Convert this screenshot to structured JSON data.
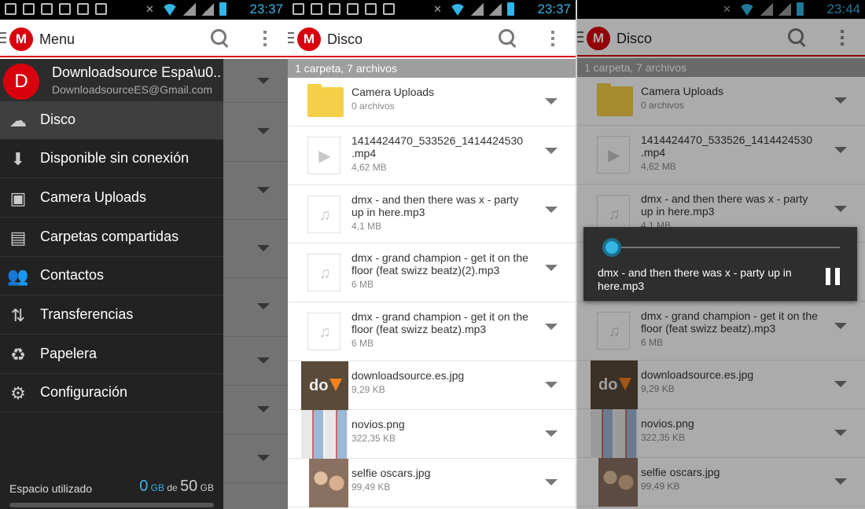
{
  "status": {
    "time1": "23:37",
    "time2": "23:37",
    "time3": "23:44"
  },
  "drawer_toolbar_title": "Menu",
  "disco_title": "Disco",
  "folder_summary": "1 carpeta, 7 archivos",
  "account": {
    "initial": "D",
    "name": "Downloadsource Espa\\u0..",
    "email": "DownloadsourceES@Gmail.com"
  },
  "nav": [
    {
      "label": "Disco",
      "icon": "cloud-icon"
    },
    {
      "label": "Disponible sin conexión",
      "icon": "download-icon"
    },
    {
      "label": "Camera Uploads",
      "icon": "image-icon"
    },
    {
      "label": "Carpetas compartidas",
      "icon": "shared-folder-icon"
    },
    {
      "label": "Contactos",
      "icon": "contacts-icon"
    },
    {
      "label": "Transferencias",
      "icon": "transfers-icon"
    },
    {
      "label": "Papelera",
      "icon": "recycle-icon"
    },
    {
      "label": "Configuración",
      "icon": "gear-icon"
    }
  ],
  "usage": {
    "label": "Espacio utilizado",
    "used": "0",
    "unit1": "GB",
    "of": "de",
    "total": "50",
    "unit2": "GB"
  },
  "files": [
    {
      "name": "Camera Uploads",
      "size": "0 archivos",
      "kind": "folder"
    },
    {
      "name": "1414424470_533526_1414424530 .mp4",
      "size": "4,62 MB",
      "kind": "video"
    },
    {
      "name": "dmx - and then there was x - party up in here.mp3",
      "size": "4,1 MB",
      "kind": "audio"
    },
    {
      "name": "dmx - grand champion - get it on the floor (feat swizz beatz)(2).mp3",
      "size": "6 MB",
      "kind": "audio"
    },
    {
      "name": "dmx - grand champion - get it on the floor (feat swizz beatz).mp3",
      "size": "6 MB",
      "kind": "audio"
    },
    {
      "name": "downloadsource.es.jpg",
      "size": "9,29 KB",
      "kind": "image-do"
    },
    {
      "name": "novios.png",
      "size": "322,35 KB",
      "kind": "image-comic"
    },
    {
      "name": "selfie oscars.jpg",
      "size": "99,49 KB",
      "kind": "image-selfie"
    }
  ],
  "thumb_text": "do",
  "player": {
    "title": "dmx - and then there was x - party up in here.mp3"
  },
  "colors": {
    "accent": "#d9000d",
    "holo": "#33b5e5"
  }
}
